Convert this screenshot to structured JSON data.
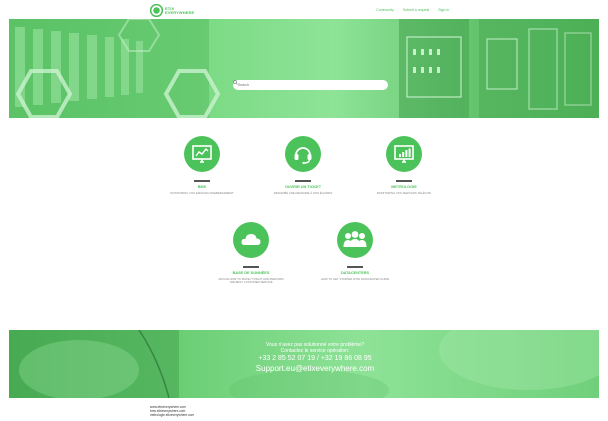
{
  "header": {
    "logo_line1": "ETIX",
    "logo_line2": "EVERYWHERE",
    "nav": [
      "Community",
      "Submit a request",
      "Sign in"
    ]
  },
  "search": {
    "placeholder": "Search"
  },
  "services": [
    {
      "title": "BMS",
      "desc": "MONITORING VOS ESPACES D'HEBERGEMENT",
      "icon": "monitor-chart-icon"
    },
    {
      "title": "OUVRIR UN TICKET",
      "desc": "DESCRIBE UNE DEMANDE À NOS ÉQUIPES",
      "icon": "headset-icon"
    },
    {
      "title": "METROLOGIE",
      "desc": "MONITORING VOS SERVICES TÉLÉCOM",
      "icon": "bar-chart-icon"
    },
    {
      "title": "BASE DE DONNÉES",
      "desc": "ADVICE HOW TO MAKE IT RIGHT AND PERFORM THE BEST CUSTOMER SERVICE",
      "icon": "cloud-icon"
    },
    {
      "title": "DATACENTERS",
      "desc": "HOW TO GET STARTED WITH DATACENTER GUIDE",
      "icon": "people-group-icon"
    }
  ],
  "contact": {
    "line1": "Vous n'avez pas solutionné votre problème?",
    "line2": "Contactez le service opération:",
    "phones": "+33 2 85 52 07 19 / +32 19 86 08 95",
    "email": "Support.eu@etixeverywhere.com"
  },
  "footer": {
    "links": [
      "www.etixeverywhere.com",
      "bms.etixeverywhere.com",
      "metrologie.etixeverywhere.com"
    ]
  },
  "colors": {
    "accent": "#4cc35a"
  }
}
